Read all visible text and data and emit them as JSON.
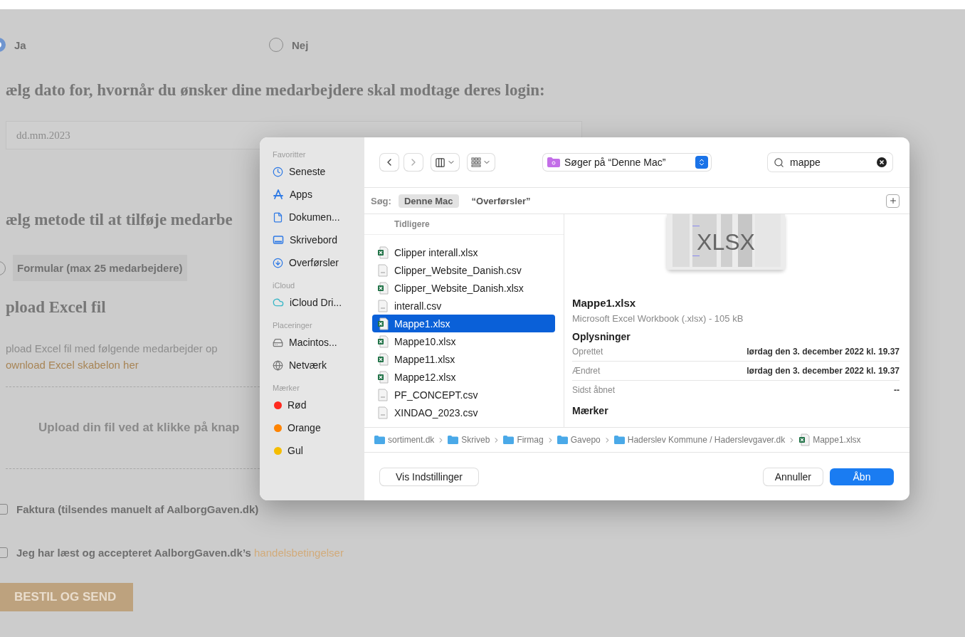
{
  "page": {
    "radios": [
      {
        "label": "Ja",
        "selected": true
      },
      {
        "label": "Nej",
        "selected": false
      }
    ],
    "date_heading": "ælg dato for, hvornår du ønsker dine medarbejdere skal modtage deres login:",
    "date_field": {
      "placeholder": "dd.mm.2023"
    },
    "method_heading": "ælg metode til at tilføje medarbe",
    "method_option": {
      "label": "Formular (max 25 medarbejdere)",
      "selected": false
    },
    "upload_heading": "pload Excel fil",
    "upload_text": "pload Excel fil med følgende medarbejder op",
    "template_link": "ownload Excel skabelon her",
    "dropzone_text": "Upload din fil ved at klikke på knap",
    "checkboxes": [
      {
        "label": "Faktura (tilsendes manuelt af AalborgGaven.dk)",
        "checked": false
      },
      {
        "label": "Jeg har læst og accepteret AalborgGaven.dk’s",
        "link": "handelsbetingelser",
        "checked": false
      }
    ],
    "submit_button": "BESTIL OG SEND"
  },
  "dialog": {
    "sidebar": [
      {
        "title": "Favoritter",
        "items": [
          {
            "label": "Seneste"
          },
          {
            "label": "Apps"
          },
          {
            "label": "Dokumen..."
          },
          {
            "label": "Skrivebord"
          },
          {
            "label": "Overførsler"
          }
        ]
      },
      {
        "title": "iCloud",
        "items": [
          {
            "label": "iCloud Dri..."
          }
        ]
      },
      {
        "title": "Placeringer",
        "items": [
          {
            "label": "Macintos..."
          },
          {
            "label": "Netværk"
          }
        ]
      },
      {
        "title": "Mærker",
        "items": [
          {
            "label": "Rød",
            "color": "#ff2a1f"
          },
          {
            "label": "Orange",
            "color": "#ff8400"
          },
          {
            "label": "Gul",
            "color": "#f5bd00"
          }
        ]
      }
    ],
    "location": "Søger på “Denne Mac”",
    "search": {
      "value": "mappe"
    },
    "scope": {
      "label": "Søg:",
      "options": [
        {
          "label": "Denne Mac",
          "selected": true
        },
        {
          "label": "“Overførsler”",
          "selected": false
        }
      ]
    },
    "list_header": "Tidligere",
    "files": [
      {
        "name": "Clipper interall.xlsx",
        "kind": "xlsx",
        "selected": false
      },
      {
        "name": "Clipper_Website_Danish.csv",
        "kind": "csv",
        "selected": false
      },
      {
        "name": "Clipper_Website_Danish.xlsx",
        "kind": "xlsx",
        "selected": false
      },
      {
        "name": "interall.csv",
        "kind": "csv",
        "selected": false
      },
      {
        "name": "Mappe1.xlsx",
        "kind": "xlsx",
        "selected": true
      },
      {
        "name": "Mappe10.xlsx",
        "kind": "xlsx",
        "selected": false
      },
      {
        "name": "Mappe11.xlsx",
        "kind": "xlsx",
        "selected": false
      },
      {
        "name": "Mappe12.xlsx",
        "kind": "xlsx",
        "selected": false
      },
      {
        "name": "PF_CONCEPT.csv",
        "kind": "csv",
        "selected": false
      },
      {
        "name": "XINDAO_2023.csv",
        "kind": "csv",
        "selected": false
      }
    ],
    "preview": {
      "thumbnail_label": "XLSX",
      "name": "Mappe1.xlsx",
      "description": "Microsoft Excel Workbook (.xlsx) - 105 kB",
      "info_heading": "Oplysninger",
      "info": [
        {
          "label": "Oprettet",
          "value": "lørdag den 3. december 2022 kl. 19.37"
        },
        {
          "label": "Ændret",
          "value": "lørdag den 3. december 2022 kl. 19.37"
        },
        {
          "label": "Sidst åbnet",
          "value": "--"
        }
      ],
      "tags_heading": "Mærker"
    },
    "path": [
      {
        "label": "sortiment.dk",
        "kind": "folder"
      },
      {
        "label": "Skriveb",
        "kind": "folder"
      },
      {
        "label": "Firmag",
        "kind": "folder"
      },
      {
        "label": "Gavepo",
        "kind": "folder"
      },
      {
        "label": "Haderslev Kommune / Haderslevgaver.dk",
        "kind": "folder"
      },
      {
        "label": "Mappe1.xlsx",
        "kind": "xlsx"
      }
    ],
    "buttons": {
      "options": "Vis Indstillinger",
      "cancel": "Annuller",
      "open": "Åbn"
    }
  }
}
